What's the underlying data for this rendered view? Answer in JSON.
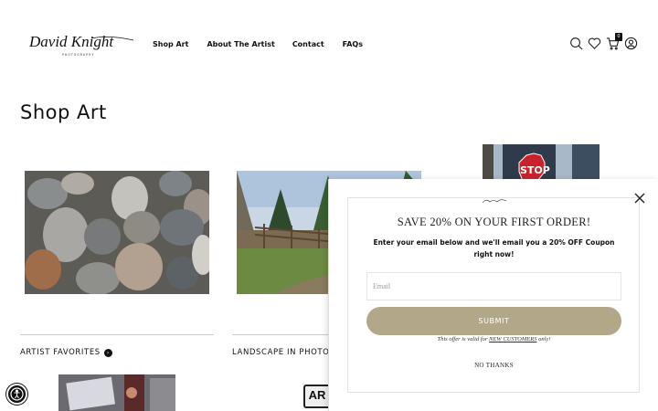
{
  "header": {
    "logo_text": "David Knight",
    "logo_subtext": "PHOTOGRAPHY",
    "nav": [
      "Shop Art",
      "About The Artist",
      "Contact",
      "FAQs"
    ],
    "cart_count": "0"
  },
  "main": {
    "title": "Shop Art",
    "categories": [
      {
        "label": "ARTIST FAVORITES"
      },
      {
        "label": "LANDSCAPE IN PHOTOG"
      }
    ],
    "thumb_text": "AR"
  },
  "popup": {
    "title": "SAVE 20% ON YOUR FIRST ORDER!",
    "subtitle": "Enter your email below and we'll email you a 20% OFF Coupon right now!",
    "email_placeholder": "Email",
    "submit_label": "SUBMIT",
    "offer_prefix": "This offer is valid for ",
    "offer_link": "NEW CUSTOMERS",
    "offer_suffix": " only!",
    "no_thanks": "NO THANKS"
  },
  "colors": {
    "accent": "#b2a788"
  }
}
